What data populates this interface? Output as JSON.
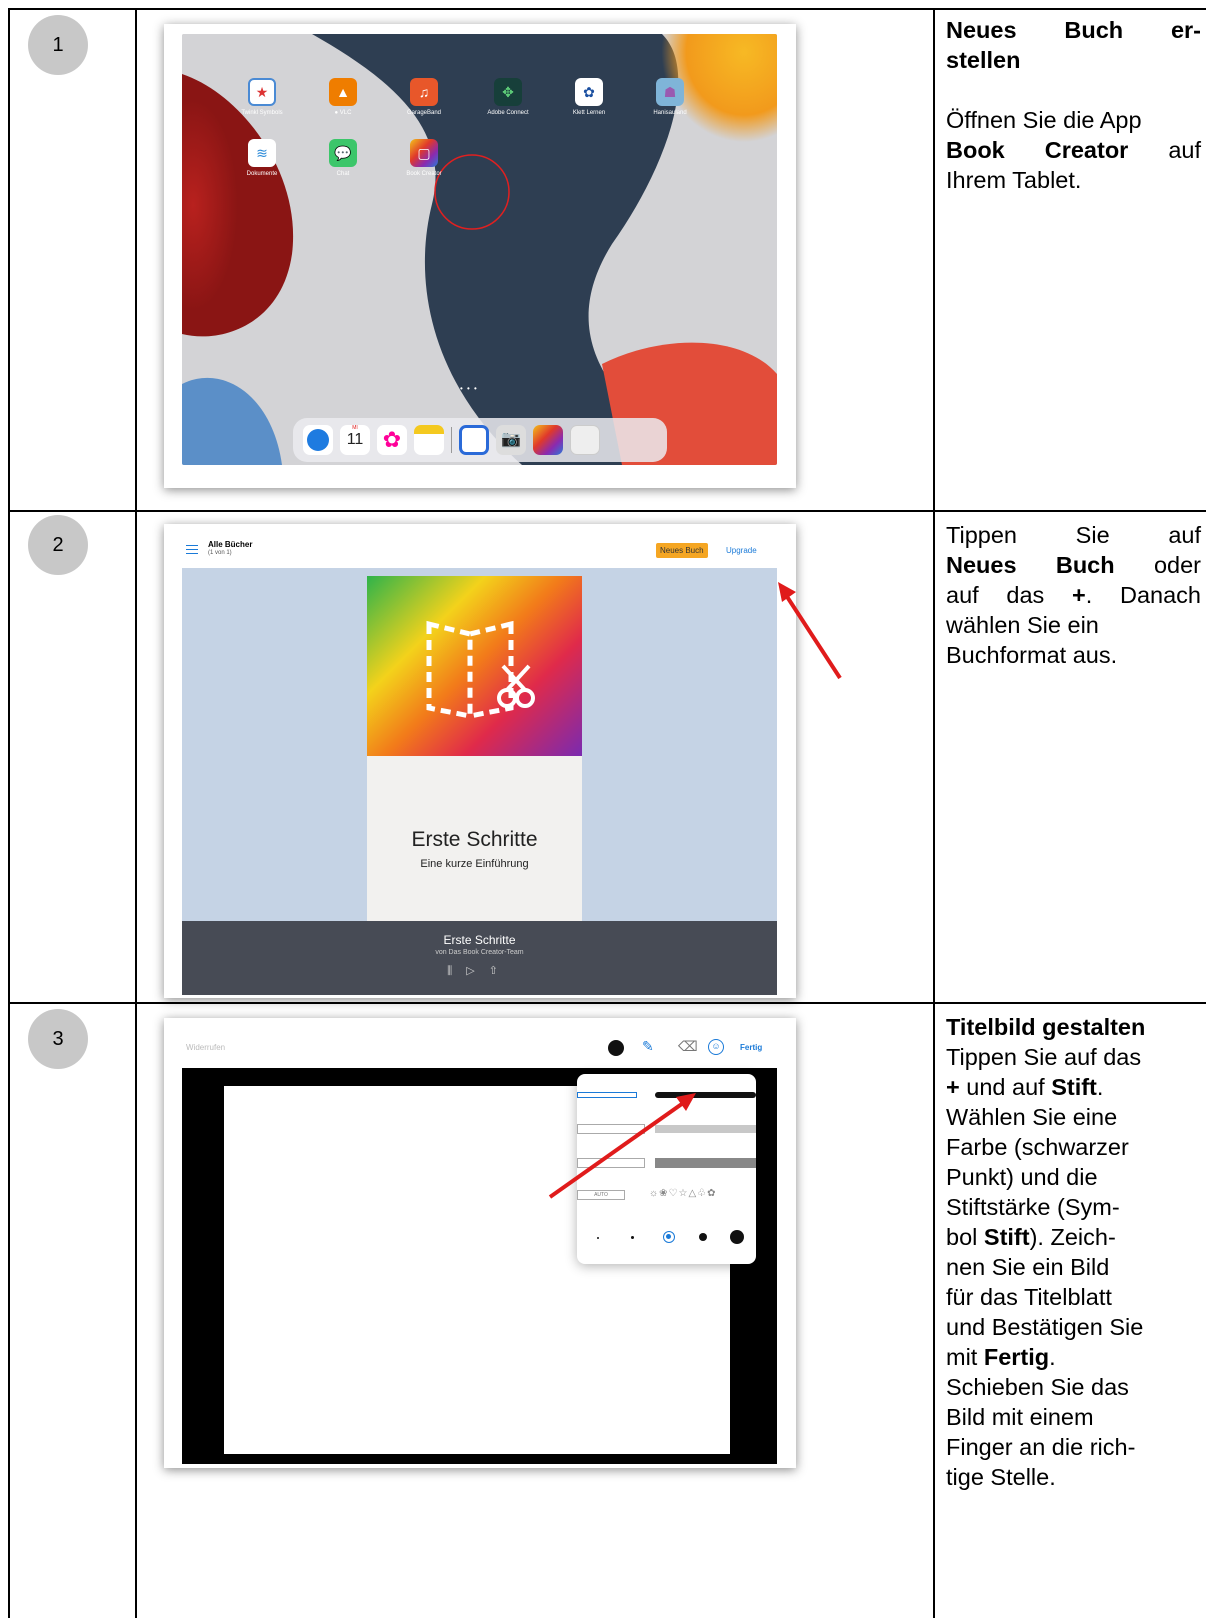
{
  "rows": [
    {
      "number": "1",
      "heading_line1": "Neues Buch er-",
      "heading_line2": "stellen",
      "text_before": "Öffnen Sie die App",
      "bold": "Book Creator",
      "text_after": "auf",
      "text_end": "Ihrem Tablet."
    },
    {
      "number": "2",
      "line1": "Tippen Sie auf",
      "bold1": "Neues Buch",
      "after1": "oder",
      "line3a": "auf das",
      "bold2": "+",
      "line3b": ". Danach",
      "line4": "wählen Sie ein",
      "line5": "Buchformat aus."
    },
    {
      "number": "3",
      "heading": "Titelbild gestalten",
      "l1": "Tippen Sie auf das",
      "l2_bold": "+",
      "l2_mid": "und auf",
      "l2_bold2": "Stift",
      "l2_end": ".",
      "l3": "Wählen Sie eine",
      "l4": "Farbe (schwarzer",
      "l5": "Punkt) und die",
      "l6": "Stiftstärke (Sym-",
      "l7a": "bol",
      "l7_bold": "Stift",
      "l7b": "). Zeich-",
      "l8": "nen Sie ein Bild",
      "l9": "für das Titelblatt",
      "l10": "und Bestätigen Sie",
      "l11a": "mit",
      "l11_bold": "Fertig",
      "l11b": ".",
      "l12": "Schieben Sie das",
      "l13": "Bild mit einem",
      "l14": "Finger an die rich-",
      "l15": "tige Stelle."
    }
  ],
  "screen1": {
    "apps": [
      "Twinkl Symbols",
      "● VLC",
      "GarageBand",
      "Adobe Connect",
      "Klett Lernen",
      "Hanisauland",
      "Dokumente",
      "Chat",
      "Book Creator"
    ],
    "dock_calendar_day": "MI",
    "dock_calendar_date": "11",
    "page_dots": "• • •"
  },
  "screen2": {
    "title": "Alle Bücher",
    "subtitle": "(1 von 1)",
    "new_book": "Neues Buch",
    "upgrade": "Upgrade",
    "cover_title": "Erste Schritte",
    "cover_subtitle": "Eine kurze Einführung",
    "bottom_title": "Erste Schritte",
    "bottom_author": "von Das Book Creator-Team"
  },
  "screen3": {
    "undo": "Widerrufen",
    "done": "Fertig",
    "auto": "AUTO"
  }
}
